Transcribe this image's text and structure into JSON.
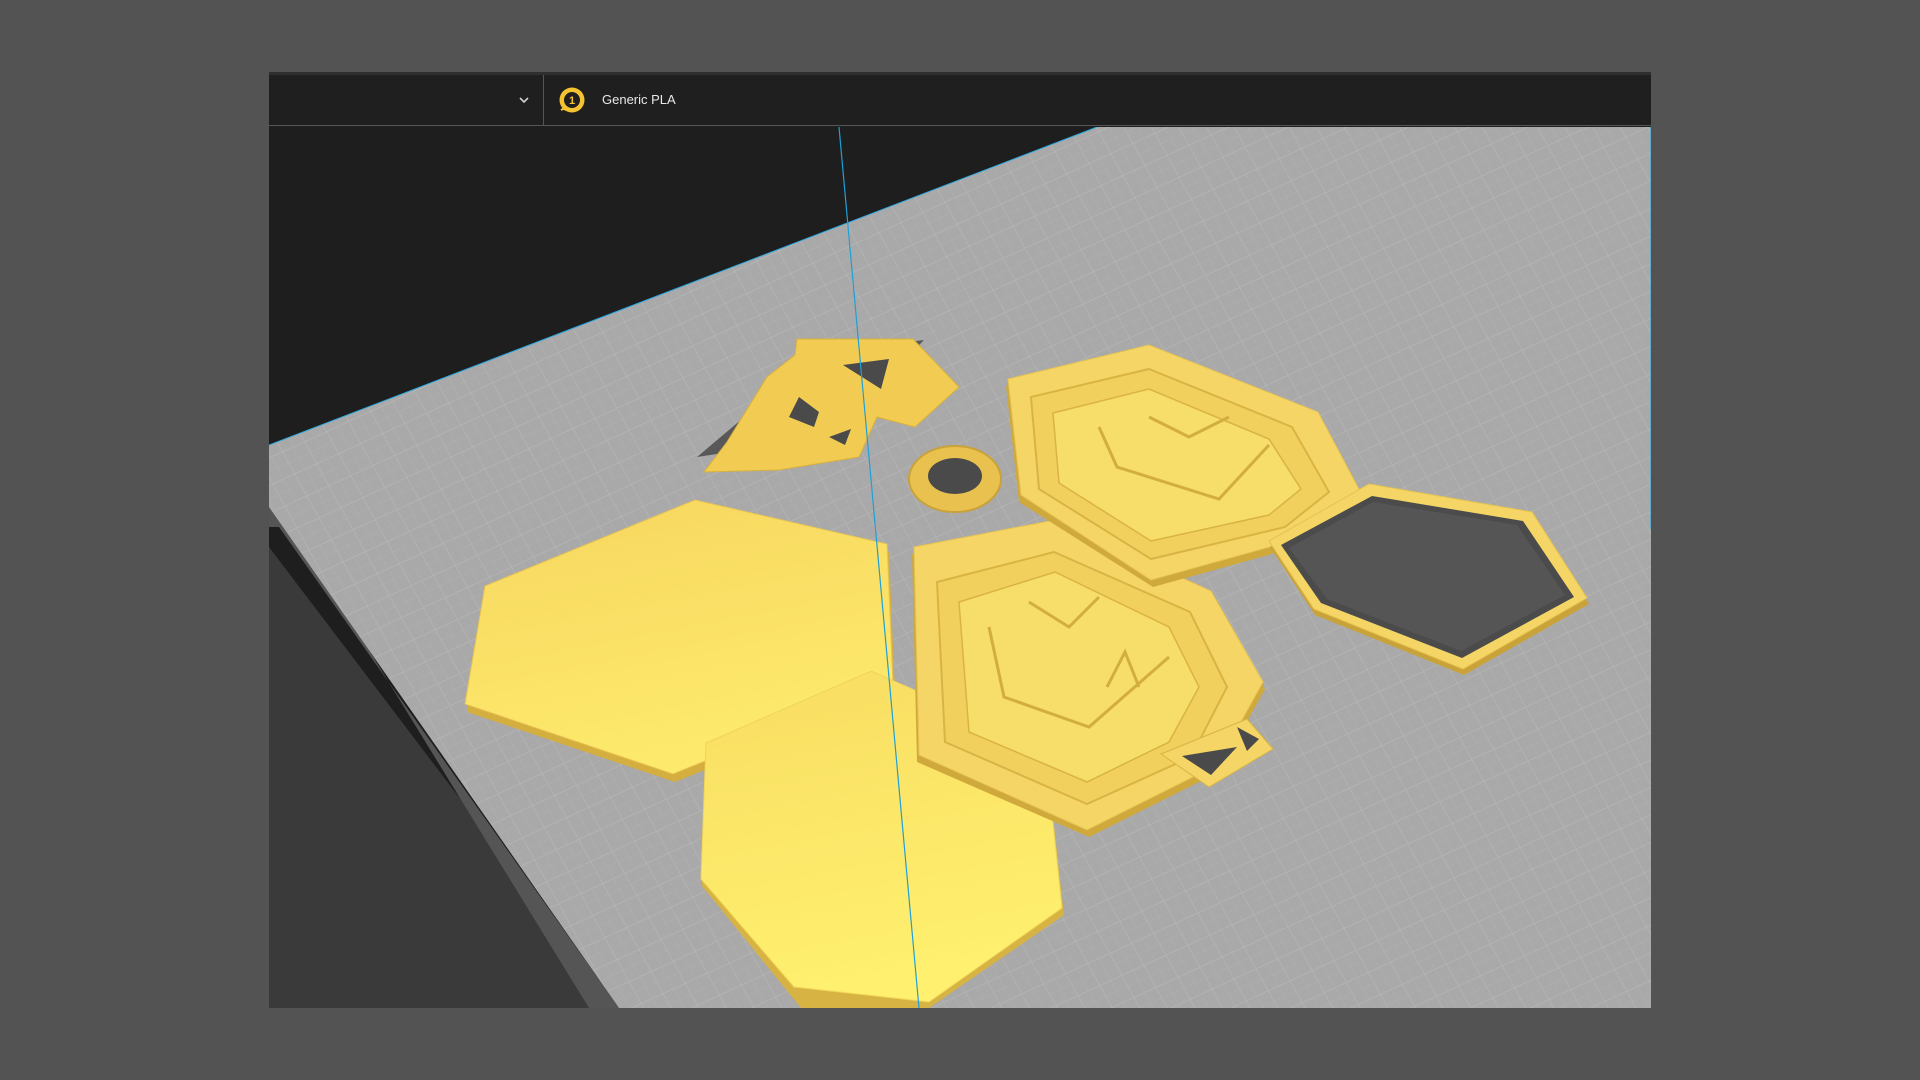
{
  "app": {
    "printer_selector": {
      "value": "",
      "chevron_icon": "chevron-down-icon"
    },
    "material_selector": {
      "extruder_number": "1",
      "extruder_icon": "extruder-badge-icon",
      "material_name": "Generic PLA"
    },
    "viewport": {
      "description_icon": "build-plate-3d-view",
      "model_color": "#f5d867",
      "plate_color": "#a9a9a9",
      "axis_color": "#1e9fd8"
    }
  }
}
